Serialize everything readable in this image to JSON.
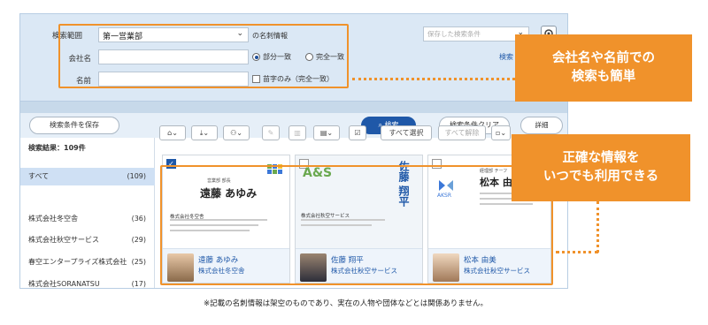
{
  "search": {
    "scope_label": "検索範囲",
    "scope_value": "第一営業部",
    "company_label": "会社名",
    "name_label": "名前",
    "card_info_label": "の名刺情報",
    "saved_conditions_placeholder": "保存した検索条件",
    "search_link": "検索",
    "match_partial": "部分一致",
    "match_exact": "完全一致",
    "initial_only": "苗字のみ（完全一致）",
    "save_conditions_button": "検索条件を保存",
    "search_button": "検索",
    "clear_button": "検索条件クリア",
    "detail_toggle": "詳細"
  },
  "results": {
    "count_label": "検索結果：109件",
    "select_all": "すべて選択",
    "deselect_all": "すべて解除"
  },
  "sidebar": {
    "items": [
      {
        "label": "すべて",
        "count": "(109)"
      },
      {
        "label": "株式会社冬空舎",
        "count": "(36)"
      },
      {
        "label": "株式会社秋空サービス",
        "count": "(29)"
      },
      {
        "label": "春空エンタープライズ株式会社",
        "count": "(25)"
      },
      {
        "label": "株式会社SORANATSU",
        "count": "(17)"
      }
    ]
  },
  "cards": [
    {
      "title": "営業部 部長",
      "name_large": "遠藤 あゆみ",
      "company_line": "株式会社冬空舎",
      "person_name": "遠藤 あゆみ",
      "person_company": "株式会社冬空舎",
      "checked": true
    },
    {
      "logo": "A&S",
      "name_vertical": "佐藤 翔平",
      "company_line": "株式会社秋空サービス",
      "person_name": "佐藤 翔平",
      "person_company": "株式会社秋空サービス",
      "checked": false
    },
    {
      "logo": "AKSR",
      "title": "経理部 チーフ",
      "name_large": "松本 由",
      "person_name": "松本 由美",
      "person_company": "株式会社秋空サービス",
      "checked": false
    }
  ],
  "callouts": {
    "top_line1": "会社名や名前での",
    "top_line2": "検索も簡単",
    "bottom_line1": "正確な情報を",
    "bottom_line2": "いつでも利用できる"
  },
  "footnote": "※記載の名刺情報は架空のものであり、実在の人物や団体などとは関係ありません。",
  "colors": {
    "accent_orange": "#f0922b",
    "primary_blue": "#1f58a8",
    "panel_blue": "#dbe8f5"
  }
}
